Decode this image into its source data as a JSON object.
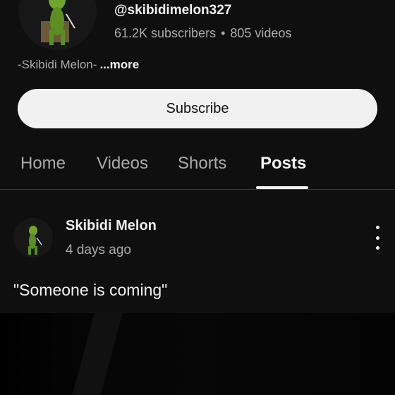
{
  "channel": {
    "handle": "@skibidimelon327",
    "subscribers": "61.2K subscribers",
    "separator": "•",
    "videos": "805 videos",
    "description": "-Skibidi Melon-",
    "more_label": "...more",
    "avatar_icon": "frog-character-avatar"
  },
  "subscribe": {
    "label": "Subscribe"
  },
  "tabs": [
    {
      "label": "Home",
      "active": false
    },
    {
      "label": "Videos",
      "active": false
    },
    {
      "label": "Shorts",
      "active": false
    },
    {
      "label": "Posts",
      "active": true
    }
  ],
  "post": {
    "author": "Skibidi Melon",
    "time": "4 days ago",
    "text": "\"Someone is coming\"",
    "menu_icon": "more-vertical-icon"
  },
  "colors": {
    "background": "#0f0f0f",
    "primary_text": "#f1f1f1",
    "secondary_text": "#aaaaaa",
    "subscribe_bg": "#f1f1f1"
  }
}
